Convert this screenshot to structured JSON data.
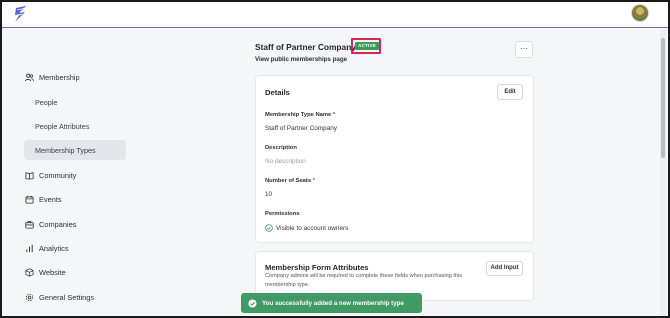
{
  "app": {
    "logo_icon": "lightning-logo-icon",
    "avatar_icon": "user-avatar"
  },
  "sidebar": {
    "items": [
      {
        "label": "Membership",
        "icon": "users-icon"
      },
      {
        "label": "People"
      },
      {
        "label": "People Attributes"
      },
      {
        "label": "Membership Types",
        "active": true
      },
      {
        "label": "Community",
        "icon": "book-icon"
      },
      {
        "label": "Events",
        "icon": "calendar-icon"
      },
      {
        "label": "Companies",
        "icon": "briefcase-icon"
      },
      {
        "label": "Analytics",
        "icon": "bar-chart-icon"
      },
      {
        "label": "Website",
        "icon": "cube-icon"
      },
      {
        "label": "General Settings",
        "icon": "gear-icon"
      }
    ]
  },
  "header": {
    "title": "Staff of Partner Company",
    "status_badge": "ACTIVE",
    "public_link": "View public memberships page",
    "more_label": "···"
  },
  "details": {
    "title": "Details",
    "edit_label": "Edit",
    "name_label": "Membership Type Name",
    "name_value": "Staff of Partner Company",
    "description_label": "Description",
    "description_value": "No description",
    "seats_label": "Number of Seats",
    "seats_value": "10",
    "permissions_label": "Permissions",
    "permissions_value": "Visible to account owners",
    "required_mark": "*"
  },
  "form_attributes": {
    "title": "Membership Form Attributes",
    "add_input_label": "Add Input",
    "description": "Company admins will be required to complete these fields when purchasing this membership type."
  },
  "toast": {
    "message": "You successfully added a new membership type"
  },
  "colors": {
    "accent": "#6e72b8",
    "badge_green": "#3e9a59",
    "highlight": "#d6245a",
    "toast_green": "#3f9a63"
  }
}
